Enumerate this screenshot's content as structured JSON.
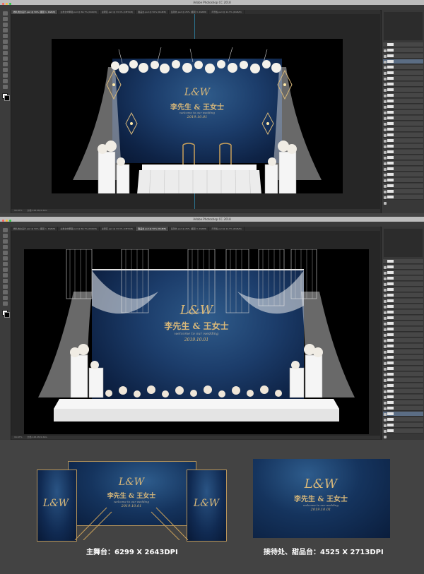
{
  "app": {
    "title": "Adobe Photoshop CC 2018",
    "tabs": [
      "婚礼舞台设计.psd @ 50% (图层 1, RGB/8)",
      "主舞台效果图.psd @ 66.7% (RGB/8)",
      "迎宾区.psd @ 33.3% (CMYK/8)",
      "甜品台.psd @ 50% (RGB/8)",
      "签到处.psd @ 25% (图层 3, RGB/8)",
      "背景板.psd @ 12.5% (RGB/8)"
    ],
    "status_zoom": "16.67%",
    "status_doc": "文档:128.0M/1.62G"
  },
  "panel": {
    "layer_labels": [
      "图层 1",
      "图层 2",
      "花艺",
      "灯光",
      "椅子",
      "桌布",
      "背景",
      "组 1",
      "图层 6",
      "图层 7"
    ]
  },
  "artwork": {
    "monogram": "L&W",
    "names": "李先生 & 王女士",
    "welcome": "welcome to our wedding",
    "date": "2019.10.01"
  },
  "captions": {
    "main_stage": "主舞台：6299 X 2643DPI",
    "reception": "接待处、甜品台：4525 X 2713DPI"
  },
  "colors": {
    "gold": "#d8b87a",
    "sky_dark": "#0e2346",
    "ps_dark": "#2b2b2b"
  }
}
